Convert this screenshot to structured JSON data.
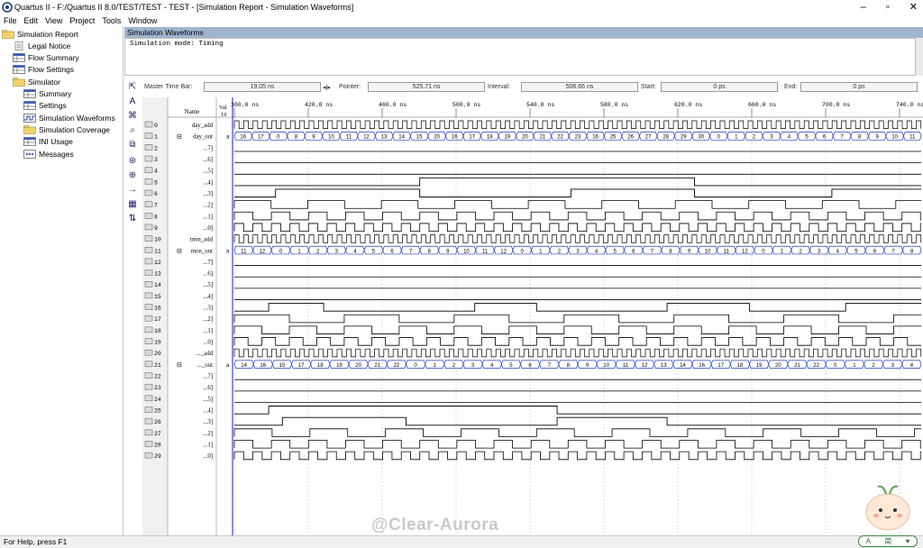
{
  "window": {
    "title": "Quartus II - F:/Quartus II 8.0/TEST/TEST - TEST - [Simulation Report - Simulation Waveforms]"
  },
  "menu": [
    "File",
    "Edit",
    "View",
    "Project",
    "Tools",
    "Window"
  ],
  "tree": [
    {
      "label": "Simulation Report",
      "icon": "folder-icon",
      "indent": 0
    },
    {
      "label": "Legal Notice",
      "icon": "document-icon",
      "indent": 1
    },
    {
      "label": "Flow Summary",
      "icon": "table-icon",
      "indent": 1
    },
    {
      "label": "Flow Settings",
      "icon": "table-icon",
      "indent": 1
    },
    {
      "label": "Simulator",
      "icon": "folder-icon",
      "indent": 1
    },
    {
      "label": "Summary",
      "icon": "table-icon",
      "indent": 2
    },
    {
      "label": "Settings",
      "icon": "table-icon",
      "indent": 2
    },
    {
      "label": "Simulation Waveforms",
      "icon": "waveform-icon",
      "indent": 2
    },
    {
      "label": "Simulation Coverage",
      "icon": "folder-icon",
      "indent": 2
    },
    {
      "label": "INI Usage",
      "icon": "table-icon",
      "indent": 2
    },
    {
      "label": "Messages",
      "icon": "messages-icon",
      "indent": 2
    }
  ],
  "panel_title": "Simulation Waveforms",
  "sim_mode": "Simulation mode: Timing",
  "timebar": {
    "master_label": "Master Time Bar:",
    "master_value": "19.05 ns",
    "pointer_label": "Pointer:",
    "pointer_value": "525.71 ns",
    "interval_label": "Interval:",
    "interval_value": "506.66 ns",
    "start_label": "Start:",
    "start_value": "0 ps",
    "end_label": "End:",
    "end_value": "0 ps"
  },
  "columns": {
    "name": "Name",
    "value": "Val\n19"
  },
  "time_ticks": [
    "300.0 ns",
    "420.0 ns",
    "460.0 ns",
    "500.0 ns",
    "540.0 ns",
    "580.0 ns",
    "620.0 ns",
    "660.0 ns",
    "700.0 ns",
    "740.0 ns"
  ],
  "signals": [
    {
      "id": "0",
      "name": "day_add",
      "group": "",
      "type": "clock"
    },
    {
      "id": "1",
      "name": "day_out",
      "group": "⊟",
      "type": "bus",
      "bus": [
        "16",
        "17",
        "0",
        "8",
        "9",
        "10",
        "11",
        "12",
        "13",
        "14",
        "15",
        "20",
        "16",
        "17",
        "18",
        "19",
        "20",
        "21",
        "22",
        "23",
        "16",
        "25",
        "26",
        "27",
        "28",
        "29",
        "30",
        "0",
        "1",
        "2",
        "3",
        "4",
        "5",
        "6",
        "7",
        "8",
        "9",
        "10",
        "11"
      ]
    },
    {
      "id": "2",
      "name": "...7]",
      "group": "",
      "type": "low"
    },
    {
      "id": "3",
      "name": "...6]",
      "group": "",
      "type": "low"
    },
    {
      "id": "4",
      "name": "...5]",
      "group": "",
      "type": "low"
    },
    {
      "id": "5",
      "name": "...4]",
      "group": "",
      "type": "wave",
      "edges": [
        0.27,
        0.67
      ]
    },
    {
      "id": "6",
      "name": "...3]",
      "group": "",
      "type": "wave",
      "edges": [
        0.06,
        0.27,
        0.49,
        0.67,
        0.87
      ]
    },
    {
      "id": "7",
      "name": "...2]",
      "group": "",
      "type": "period",
      "period": 0.107
    },
    {
      "id": "8",
      "name": "...1]",
      "group": "",
      "type": "period",
      "period": 0.054
    },
    {
      "id": "9",
      "name": "...0]",
      "group": "",
      "type": "period",
      "period": 0.027
    },
    {
      "id": "10",
      "name": "mon_add",
      "group": "",
      "type": "clock"
    },
    {
      "id": "11",
      "name": "mon_out",
      "group": "⊟",
      "type": "bus",
      "bus": [
        "11",
        "12",
        "0",
        "1",
        "2",
        "3",
        "4",
        "5",
        "6",
        "7",
        "8",
        "9",
        "10",
        "11",
        "12",
        "0",
        "1",
        "2",
        "3",
        "4",
        "5",
        "6",
        "7",
        "8",
        "9",
        "10",
        "11",
        "12",
        "0",
        "1",
        "2",
        "3",
        "4",
        "5",
        "6",
        "7",
        "8"
      ]
    },
    {
      "id": "12",
      "name": "...7]",
      "group": "",
      "type": "low"
    },
    {
      "id": "13",
      "name": "...6]",
      "group": "",
      "type": "low"
    },
    {
      "id": "14",
      "name": "...5]",
      "group": "",
      "type": "low"
    },
    {
      "id": "15",
      "name": "...4]",
      "group": "",
      "type": "low"
    },
    {
      "id": "16",
      "name": "...3]",
      "group": "",
      "type": "wave",
      "edges": [
        0.05,
        0.13,
        0.35,
        0.44,
        0.63,
        0.75,
        0.89
      ]
    },
    {
      "id": "17",
      "name": "...2]",
      "group": "",
      "type": "period",
      "period": 0.16
    },
    {
      "id": "18",
      "name": "...1]",
      "group": "",
      "type": "period",
      "period": 0.08
    },
    {
      "id": "19",
      "name": "...0]",
      "group": "",
      "type": "period",
      "period": 0.04
    },
    {
      "id": "20",
      "name": "..._add",
      "group": "",
      "type": "clock"
    },
    {
      "id": "21",
      "name": "..._out",
      "group": "⊟",
      "type": "bus",
      "bus": [
        "14",
        "16",
        "15",
        "17",
        "18",
        "19",
        "20",
        "21",
        "22",
        "0",
        "1",
        "2",
        "3",
        "4",
        "5",
        "6",
        "7",
        "8",
        "9",
        "10",
        "11",
        "12",
        "13",
        "14",
        "16",
        "17",
        "18",
        "19",
        "20",
        "21",
        "22",
        "0",
        "1",
        "2",
        "3",
        "4"
      ]
    },
    {
      "id": "22",
      "name": "...7]",
      "group": "",
      "type": "low"
    },
    {
      "id": "23",
      "name": "...6]",
      "group": "",
      "type": "low"
    },
    {
      "id": "24",
      "name": "...5]",
      "group": "",
      "type": "low"
    },
    {
      "id": "25",
      "name": "...4]",
      "group": "",
      "type": "wave",
      "edges": [
        0.05,
        0.47
      ]
    },
    {
      "id": "26",
      "name": "...3]",
      "group": "",
      "type": "wave",
      "edges": [
        0.07,
        0.25,
        0.47,
        0.63
      ]
    },
    {
      "id": "27",
      "name": "...2]",
      "group": "",
      "type": "period",
      "period": 0.11
    },
    {
      "id": "28",
      "name": "...1]",
      "group": "",
      "type": "period",
      "period": 0.054
    },
    {
      "id": "29",
      "name": "...0]",
      "group": "",
      "type": "period",
      "period": 0.027
    }
  ],
  "status_text": "For Help, press F1",
  "watermark": "@Clear-Aurora",
  "ime": {
    "left": "A",
    "mid": "简"
  }
}
